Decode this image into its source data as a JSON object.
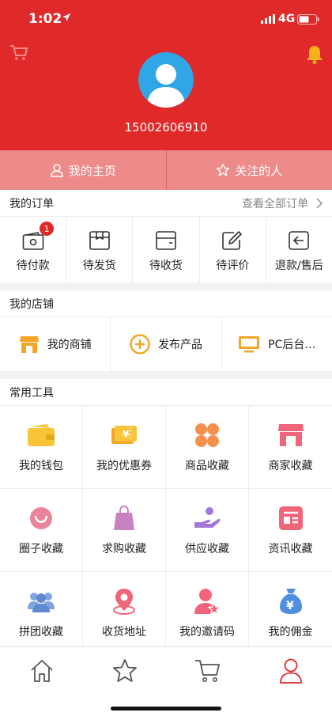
{
  "status_bar": {
    "time": "1:02",
    "network": "4G"
  },
  "header": {
    "phone": "15002606910"
  },
  "home_tabs": [
    {
      "label": "我的主页"
    },
    {
      "label": "关注的人"
    }
  ],
  "orders": {
    "title": "我的订单",
    "more": "查看全部订单",
    "items": [
      {
        "label": "待付款",
        "badge": "1"
      },
      {
        "label": "待发货"
      },
      {
        "label": "待收货"
      },
      {
        "label": "待评价"
      },
      {
        "label": "退款/售后"
      }
    ]
  },
  "shop": {
    "title": "我的店铺",
    "items": [
      {
        "label": "我的商铺"
      },
      {
        "label": "发布产品"
      },
      {
        "label": "PC后台…"
      }
    ]
  },
  "tools": {
    "title": "常用工具",
    "items": [
      {
        "label": "我的钱包"
      },
      {
        "label": "我的优惠券"
      },
      {
        "label": "商品收藏"
      },
      {
        "label": "商家收藏"
      },
      {
        "label": "圈子收藏"
      },
      {
        "label": "求购收藏"
      },
      {
        "label": "供应收藏"
      },
      {
        "label": "资讯收藏"
      },
      {
        "label": "拼团收藏"
      },
      {
        "label": "收货地址"
      },
      {
        "label": "我的邀请码"
      },
      {
        "label": "我的佣金"
      }
    ]
  },
  "colors": {
    "brand_red": "#e02a2a",
    "tab_pink": "#ec8b8a",
    "avatar_blue": "#2fa6e5",
    "bell_yellow": "#f5b01c"
  },
  "icons": {
    "bottom_nav": [
      "home-icon",
      "star-icon",
      "cart-icon",
      "user-icon"
    ]
  }
}
